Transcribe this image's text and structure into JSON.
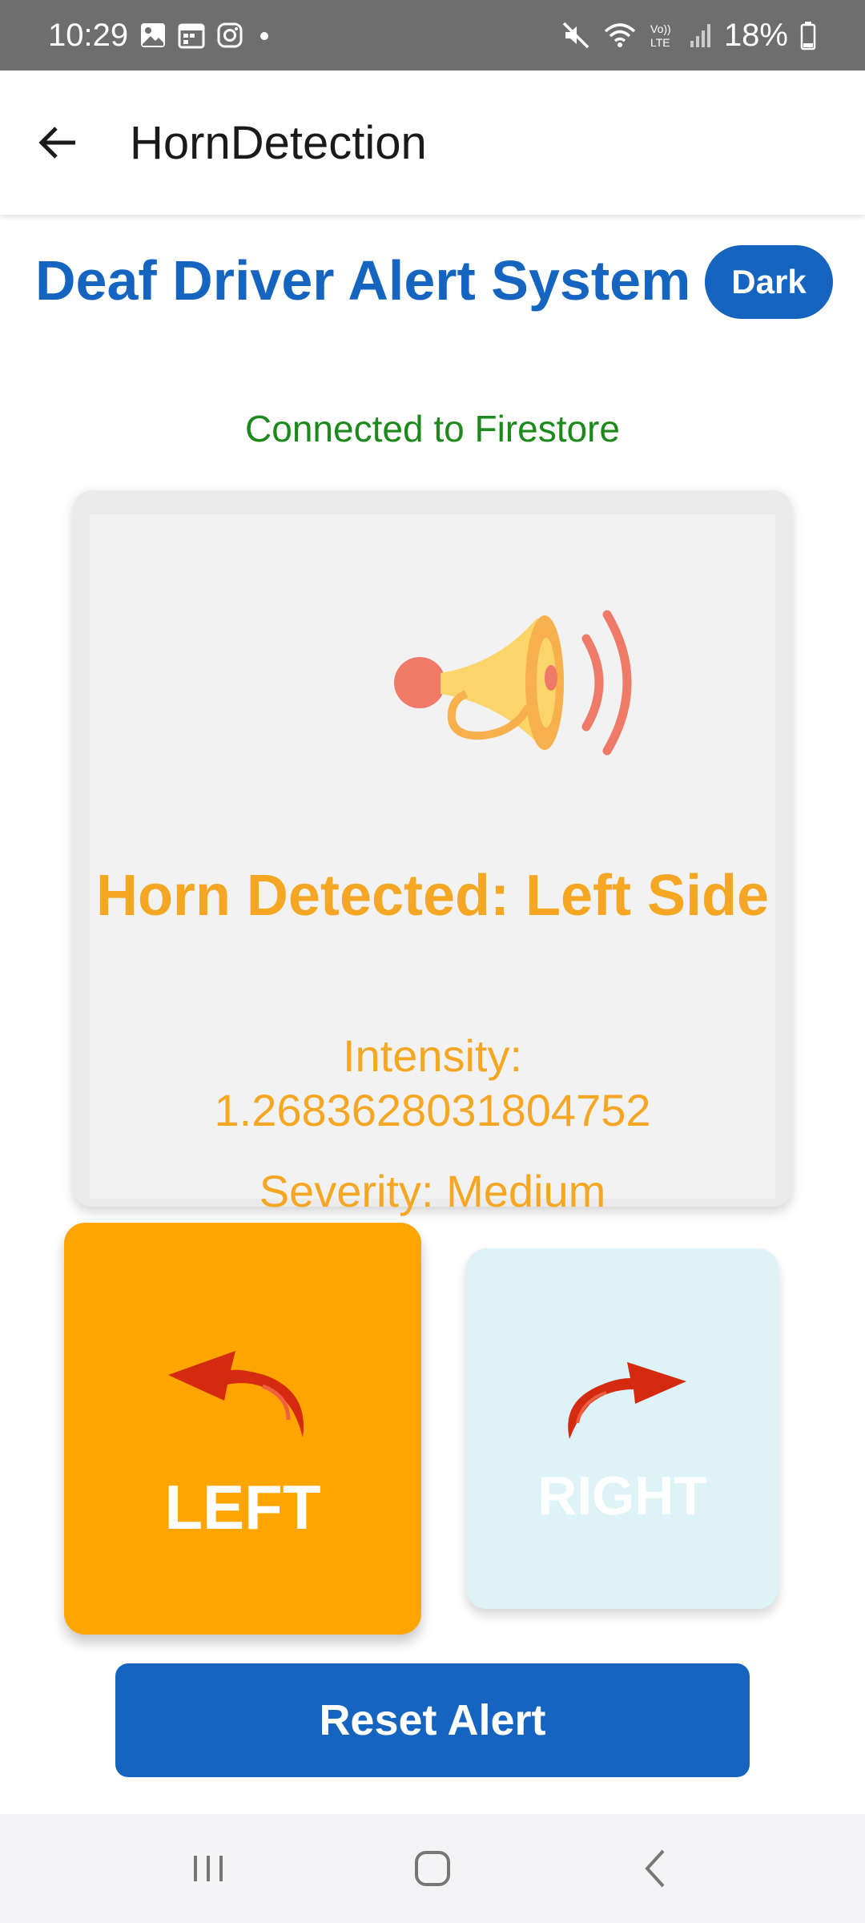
{
  "status_bar": {
    "time": "10:29",
    "battery": "18%",
    "icons": [
      "gallery-icon",
      "calendar-icon",
      "instagram-icon",
      "dot-icon",
      "mute-icon",
      "wifi-icon",
      "volte-icon",
      "signal-icon",
      "battery-icon"
    ]
  },
  "app_bar": {
    "title": "HornDetection"
  },
  "header": {
    "title": "Deaf Driver Alert System",
    "mode_toggle": "Dark"
  },
  "connection": {
    "status": "Connected to Firestore",
    "color": "#1b8a1b"
  },
  "alert": {
    "title": "Horn Detected: Left Side",
    "intensity_line": "Intensity:",
    "intensity_value": "1.2683628031804752",
    "severity": "Severity: Medium",
    "color": "#f5a623",
    "icon": "horn-icon"
  },
  "directions": {
    "left": {
      "label": "LEFT",
      "active": true,
      "color": "#ffa500"
    },
    "right": {
      "label": "RIGHT",
      "active": false,
      "color": "#ddf3f7"
    }
  },
  "actions": {
    "reset_label": "Reset Alert"
  },
  "colors": {
    "primary": "#1565c0"
  }
}
